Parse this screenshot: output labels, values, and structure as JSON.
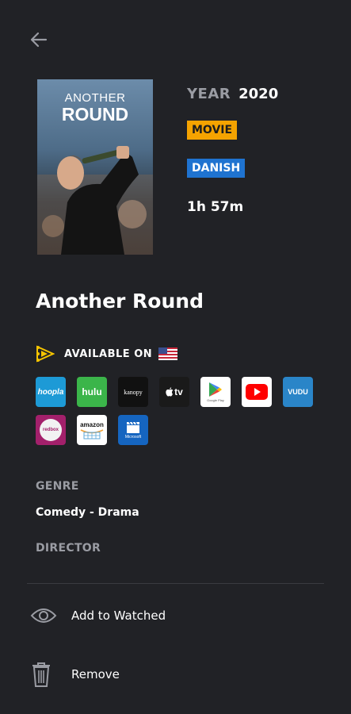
{
  "poster": {
    "title_line1": "ANOTHER",
    "title_line2": "ROUND"
  },
  "meta": {
    "year_label": "YEAR",
    "year_value": "2020",
    "type_badge": "MOVIE",
    "language_badge": "DANISH",
    "runtime": "1h 57m"
  },
  "title": "Another Round",
  "availability": {
    "label": "AVAILABLE ON",
    "providers": [
      {
        "name": "hoopla",
        "label": "hoopla"
      },
      {
        "name": "hulu",
        "label": "hulu"
      },
      {
        "name": "kanopy",
        "label": "kanopy"
      },
      {
        "name": "apple-tv",
        "label": "tv"
      },
      {
        "name": "google-play",
        "label": "Google Play"
      },
      {
        "name": "youtube",
        "label": ""
      },
      {
        "name": "vudu",
        "label": "VUDU"
      },
      {
        "name": "redbox",
        "label": "redbox"
      },
      {
        "name": "amazon",
        "label": "amazon"
      },
      {
        "name": "microsoft",
        "label": "Microsoft"
      }
    ]
  },
  "details": {
    "genre_label": "GENRE",
    "genre_value": "Comedy - Drama",
    "director_label": "DIRECTOR"
  },
  "actions": {
    "watched_label": "Add to Watched",
    "remove_label": "Remove"
  },
  "colors": {
    "background": "#212226",
    "movie_badge": "#f5a300",
    "language_badge": "#1f73d0",
    "muted_label": "#9a9ca3"
  }
}
